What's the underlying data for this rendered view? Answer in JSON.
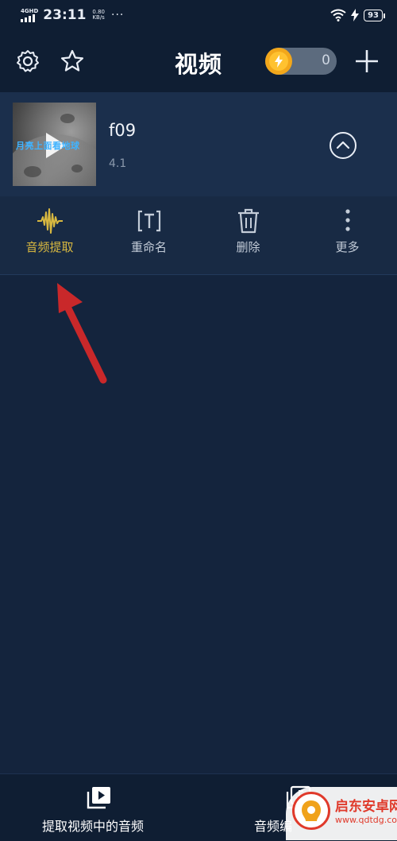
{
  "status_bar": {
    "network": "4GHD",
    "time": "23:11",
    "speed_value": "0.80",
    "speed_unit": "KB/s",
    "dots": "···",
    "battery": "93"
  },
  "header": {
    "title": "视频",
    "icons": [
      "gear-icon",
      "star-icon",
      "plus-icon"
    ],
    "toggle_count": "0",
    "accent": "#f2a71b"
  },
  "file": {
    "name": "f09",
    "meta": "4.1",
    "thumbnail_caption": "月亮上面看地球"
  },
  "actions": [
    {
      "label": "音频提取",
      "icon": "audio-wave-icon",
      "color": "#d8b840"
    },
    {
      "label": "重命名",
      "icon": "rename-icon"
    },
    {
      "label": "删除",
      "icon": "trash-icon"
    },
    {
      "label": "更多",
      "icon": "more-vertical-icon"
    }
  ],
  "bottom_nav": [
    {
      "label": "提取视频中的音频",
      "icon": "video-play-icon"
    },
    {
      "label": "音频编",
      "icon": "music-file-icon"
    }
  ],
  "watermark": {
    "text": "启东安卓网",
    "url": "www.qdtdg.com"
  }
}
